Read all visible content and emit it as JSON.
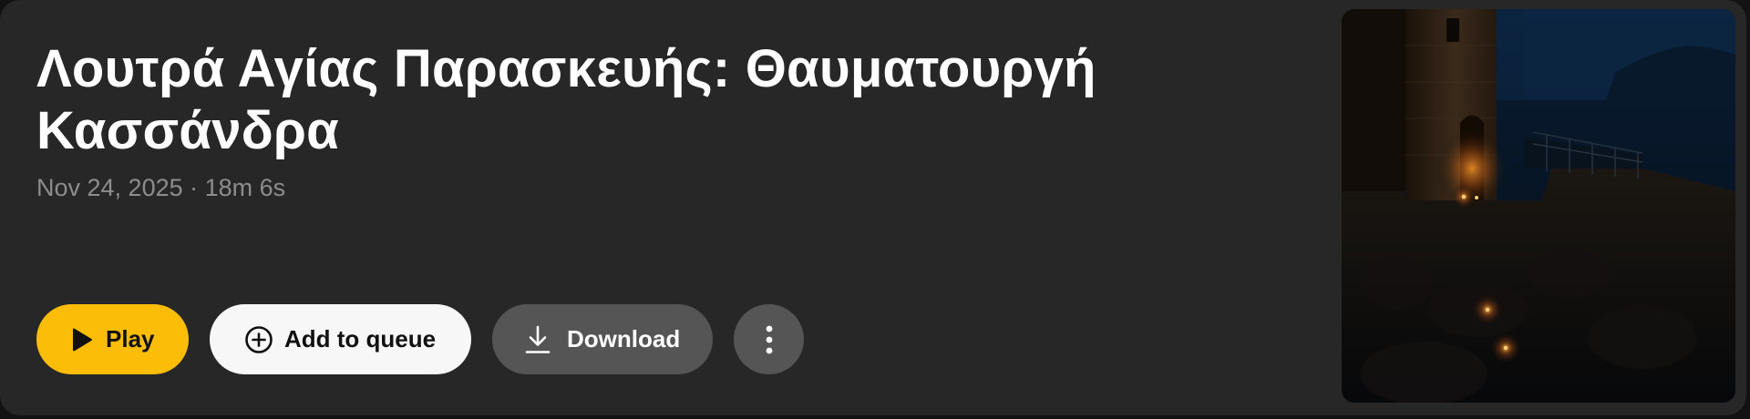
{
  "episode": {
    "title": "Λουτρά Αγίας Παρασκευής: Θαυματουργή Κασσάνδρα",
    "meta": "Nov 24, 2025 · 18m 6s"
  },
  "actions": {
    "play_label": "Play",
    "queue_label": "Add to queue",
    "download_label": "Download"
  },
  "icons": {
    "play": "play-icon",
    "queue": "plus-circle-icon",
    "download": "download-icon",
    "more": "more-vertical-icon"
  },
  "colors": {
    "card_background": "#272727",
    "play_accent": "#fbbd08",
    "queue_button": "#f7f7f7",
    "download_button": "#555555",
    "meta_text": "#8d8d8d"
  }
}
